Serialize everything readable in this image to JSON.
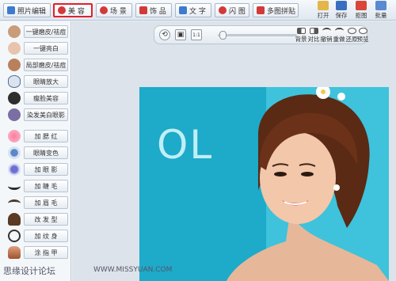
{
  "toolbar": {
    "tabs": [
      {
        "label": "照片编辑",
        "color": "#3d7bd0"
      },
      {
        "label": "美 容",
        "color": "#d23a3a"
      },
      {
        "label": "场 景",
        "color": "#d23a3a"
      },
      {
        "label": "饰 品",
        "color": "#d23a3a"
      },
      {
        "label": "文 字",
        "color": "#3d7bd0"
      },
      {
        "label": "闪 图",
        "color": "#d23a3a"
      },
      {
        "label": "多图拼贴",
        "color": "#d23a3a"
      }
    ],
    "tools": [
      {
        "label": "打开",
        "icon": "folder-icon"
      },
      {
        "label": "保存",
        "icon": "save-icon"
      },
      {
        "label": "拒图",
        "icon": "crop-icon"
      },
      {
        "label": "批量",
        "icon": "batch-icon"
      }
    ],
    "accent": "#e1212b"
  },
  "sidebar": {
    "items": [
      {
        "label": "一键磨皮/祛痘",
        "icon": "face-smooth-icon",
        "color": "#b38a6a"
      },
      {
        "label": "一键亮白",
        "icon": "face-white-icon",
        "color": "#c8a08a"
      },
      {
        "label": "局部磨皮/祛痘",
        "icon": "face-local-icon",
        "color": "#b37a55"
      },
      {
        "label": "眼睛放大",
        "icon": "eye-enlarge-icon",
        "color": "#4c6e9a"
      },
      {
        "label": "瘦脸美容",
        "icon": "face-thin-icon",
        "color": "#3a3a3a"
      },
      {
        "label": "染发美白眼影",
        "icon": "pigment-icon",
        "color": "#7a6ea3"
      },
      {
        "label": "加 腮 红",
        "icon": "blush-icon",
        "color": "#e06b8a"
      },
      {
        "label": "眼睛变色",
        "icon": "eye-color-icon",
        "color": "#5c88c9"
      },
      {
        "label": "加 眼 影",
        "icon": "eyeshadow-icon",
        "color": "#6a6fd0"
      },
      {
        "label": "加 睫 毛",
        "icon": "eyelash-icon",
        "color": "#2a2a2a"
      },
      {
        "label": "加 眉 毛",
        "icon": "eyebrow-icon",
        "color": "#4a3a2a"
      },
      {
        "label": "改 发 型",
        "icon": "hairstyle-icon",
        "color": "#5a3a22"
      },
      {
        "label": "加 纹 身",
        "icon": "tattoo-icon",
        "color": "#333333"
      },
      {
        "label": "涂 指 甲",
        "icon": "nail-icon",
        "color": "#a0522d"
      }
    ]
  },
  "canvas": {
    "controls": [
      {
        "label": "背景",
        "icon": "background-icon"
      },
      {
        "label": "对比",
        "icon": "compare-icon"
      },
      {
        "label": "撤销",
        "icon": "undo-icon"
      },
      {
        "label": "重做",
        "icon": "redo-icon"
      },
      {
        "label": "还原",
        "icon": "restore-icon"
      },
      {
        "label": "预览",
        "icon": "preview-icon"
      }
    ],
    "ratio_label": "1:1",
    "zoom_level": 0.02,
    "photo_text": "OL"
  },
  "watermark": {
    "left": "思缘设计论坛",
    "right": "WWW.MISSYUAN.COM"
  }
}
